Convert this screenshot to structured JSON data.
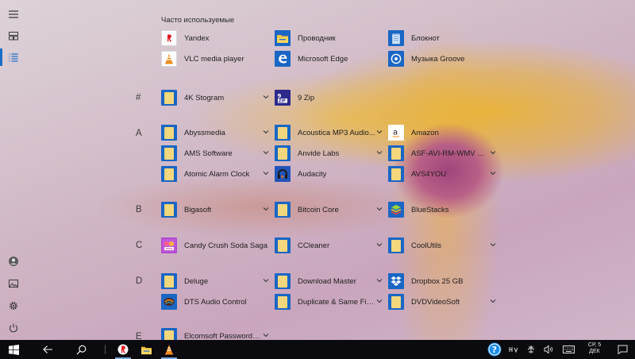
{
  "rail": {
    "items": [
      {
        "name": "hamburger-menu",
        "icon": "menu-icon"
      },
      {
        "name": "tiles-view",
        "icon": "tiles-icon"
      },
      {
        "name": "all-apps-list",
        "icon": "list-icon"
      },
      {
        "name": "user-account",
        "icon": "user-icon"
      },
      {
        "name": "pictures",
        "icon": "picture-icon"
      },
      {
        "name": "settings",
        "icon": "gear-icon"
      },
      {
        "name": "power",
        "icon": "power-icon"
      }
    ],
    "accent": "#1c6ec7"
  },
  "most_used": {
    "title": "Часто используемые",
    "apps": [
      {
        "label": "Yandex",
        "icon": "yandex-icon"
      },
      {
        "label": "VLC media player",
        "icon": "vlc-icon"
      },
      {
        "label": "Проводник",
        "icon": "explorer-icon"
      },
      {
        "label": "Microsoft Edge",
        "icon": "edge-icon"
      },
      {
        "label": "Блокнот",
        "icon": "notepad-icon"
      },
      {
        "label": "Музыка Groove",
        "icon": "groove-icon"
      }
    ]
  },
  "groups": [
    {
      "letter": "#",
      "apps": [
        {
          "label": "4K Stogram",
          "icon": "folder-icon",
          "expandable": true
        },
        {
          "label": "9 Zip",
          "icon": "9zip-icon",
          "expandable": false
        }
      ]
    },
    {
      "letter": "A",
      "apps": [
        {
          "label": "Abyssmedia",
          "icon": "folder-icon",
          "expandable": true
        },
        {
          "label": "AMS Software",
          "icon": "folder-icon",
          "expandable": true
        },
        {
          "label": "Atomic Alarm Clock",
          "icon": "folder-icon",
          "expandable": true
        },
        {
          "label": "Acoustica MP3 Audio...",
          "icon": "folder-icon",
          "expandable": true
        },
        {
          "label": "Anvide Labs",
          "icon": "folder-icon",
          "expandable": true
        },
        {
          "label": "Audacity",
          "icon": "audacity-icon",
          "expandable": false
        },
        {
          "label": "Amazon",
          "icon": "amazon-icon",
          "expandable": false
        },
        {
          "label": "ASF-AVI-RM-WMV Re...",
          "icon": "folder-icon",
          "expandable": true
        },
        {
          "label": "AVS4YOU",
          "icon": "folder-icon",
          "expandable": true
        }
      ]
    },
    {
      "letter": "B",
      "apps": [
        {
          "label": "Bigasoft",
          "icon": "folder-icon",
          "expandable": true
        },
        {
          "label": "Bitcoin Core",
          "icon": "folder-icon",
          "expandable": true
        },
        {
          "label": "BlueStacks",
          "icon": "bluestacks-icon",
          "expandable": false
        }
      ]
    },
    {
      "letter": "C",
      "apps": [
        {
          "label": "Candy Crush Soda Saga",
          "icon": "candy-crush-icon",
          "expandable": false
        },
        {
          "label": "CCleaner",
          "icon": "folder-icon",
          "expandable": true
        },
        {
          "label": "CoolUtils",
          "icon": "folder-icon",
          "expandable": true
        }
      ]
    },
    {
      "letter": "D",
      "apps": [
        {
          "label": "Deluge",
          "icon": "folder-icon",
          "expandable": true
        },
        {
          "label": "DTS Audio Control",
          "icon": "dts-icon",
          "expandable": false
        },
        {
          "label": "Download Master",
          "icon": "folder-icon",
          "expandable": true
        },
        {
          "label": "Duplicate & Same Files...",
          "icon": "folder-icon",
          "expandable": true
        },
        {
          "label": "Dropbox 25 GB",
          "icon": "dropbox-icon",
          "expandable": false
        },
        {
          "label": "DVDVideoSoft",
          "icon": "folder-icon",
          "expandable": true
        }
      ]
    },
    {
      "letter": "E",
      "apps": [
        {
          "label": "Elcomsoft Password Re...",
          "icon": "folder-icon",
          "expandable": true
        }
      ]
    }
  ],
  "taskbar": {
    "pinned": [
      {
        "name": "start",
        "icon": "windows-icon"
      },
      {
        "name": "back",
        "icon": "back-arrow-icon"
      },
      {
        "name": "search",
        "icon": "search-icon"
      },
      {
        "name": "yandex",
        "icon": "yandex-icon"
      },
      {
        "name": "file-explorer",
        "icon": "explorer-icon"
      },
      {
        "name": "vlc",
        "icon": "vlc-icon"
      }
    ],
    "tray": {
      "help_icon": "help-icon",
      "clock_day": "СР, 5",
      "clock_month": "ДЕК"
    }
  }
}
